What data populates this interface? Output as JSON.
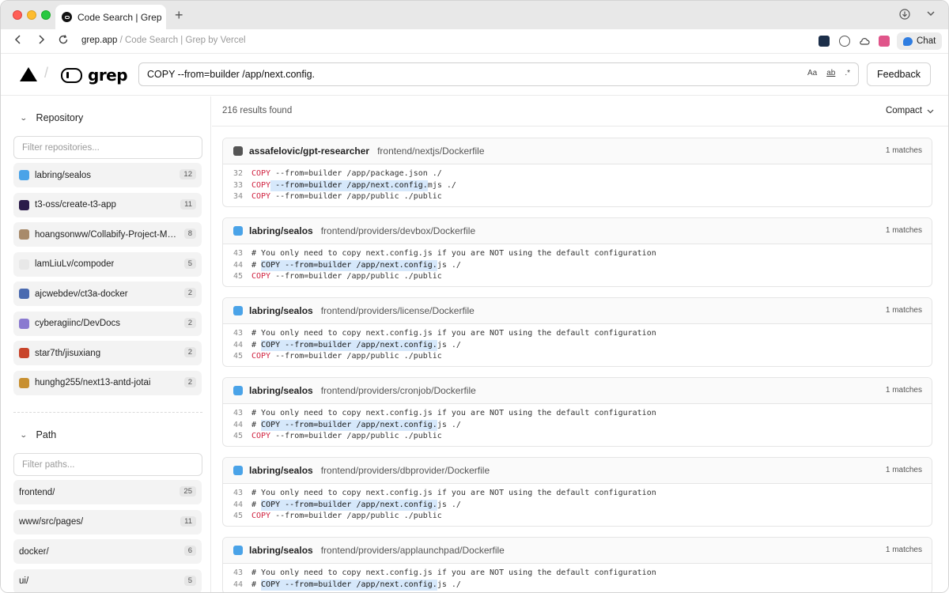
{
  "browser": {
    "tab_title": "Code Search | Grep by",
    "new_tab": "+",
    "url_host": "grep.app",
    "url_rest": " / Code Search | Grep by Vercel",
    "chat_label": "Chat"
  },
  "header": {
    "logo_text": "grep",
    "search_value": "COPY --from=builder /app/next.config.",
    "opt_case": "Aa",
    "opt_words": "ab",
    "opt_regex": ".*",
    "feedback_label": "Feedback"
  },
  "sidebar": {
    "repo_heading": "Repository",
    "repo_filter_placeholder": "Filter repositories...",
    "repos": [
      {
        "name": "labring/sealos",
        "count": "12",
        "color": "#4aa3e8"
      },
      {
        "name": "t3-oss/create-t3-app",
        "count": "11",
        "color": "#2b1b4a"
      },
      {
        "name": "hoangsonww/Collabify-Project-Man...",
        "count": "8",
        "color": "#a88a6a"
      },
      {
        "name": "lamLiuLv/compoder",
        "count": "5",
        "color": "#e8e8e8"
      },
      {
        "name": "ajcwebdev/ct3a-docker",
        "count": "2",
        "color": "#4a6ab0"
      },
      {
        "name": "cyberagiinc/DevDocs",
        "count": "2",
        "color": "#8a7ad0"
      },
      {
        "name": "star7th/jisuxiang",
        "count": "2",
        "color": "#c8442a"
      },
      {
        "name": "hunghg255/next13-antd-jotai",
        "count": "2",
        "color": "#c89030"
      }
    ],
    "path_heading": "Path",
    "path_filter_placeholder": "Filter paths...",
    "paths": [
      {
        "name": "frontend/",
        "count": "25"
      },
      {
        "name": "www/src/pages/",
        "count": "11"
      },
      {
        "name": "docker/",
        "count": "6"
      },
      {
        "name": "ui/",
        "count": "5"
      }
    ]
  },
  "results": {
    "count_text": "216 results found",
    "view_mode": "Compact",
    "items": [
      {
        "repo": "assafelovic/gpt-researcher",
        "path": "frontend/nextjs/Dockerfile",
        "matches": "1 matches",
        "icon_color": "#555555",
        "lines": [
          {
            "n": "32",
            "kind": "copy",
            "pre": "",
            "kw": "COPY",
            "hl": "",
            "rest": " --from=builder /app/package.json ./"
          },
          {
            "n": "33",
            "kind": "copyhl",
            "pre": "",
            "kw": "COPY",
            "hl": " --from=builder /app/next.config.",
            "rest": "mjs ./"
          },
          {
            "n": "34",
            "kind": "copy",
            "pre": "",
            "kw": "COPY",
            "hl": "",
            "rest": " --from=builder /app/public ./public"
          }
        ]
      },
      {
        "repo": "labring/sealos",
        "path": "frontend/providers/devbox/Dockerfile",
        "matches": "1 matches",
        "icon_color": "#4aa3e8",
        "lines": [
          {
            "n": "43",
            "kind": "comment",
            "pre": "# You only need to copy next.config.js if you are NOT using the default configuration",
            "kw": "",
            "hl": "",
            "rest": ""
          },
          {
            "n": "44",
            "kind": "commenthl",
            "pre": "# ",
            "kw": "",
            "hl": "COPY --from=builder /app/next.config.",
            "rest": "js ./"
          },
          {
            "n": "45",
            "kind": "copy",
            "pre": "",
            "kw": "COPY",
            "hl": "",
            "rest": " --from=builder /app/public ./public"
          }
        ]
      },
      {
        "repo": "labring/sealos",
        "path": "frontend/providers/license/Dockerfile",
        "matches": "1 matches",
        "icon_color": "#4aa3e8",
        "lines": [
          {
            "n": "43",
            "kind": "comment",
            "pre": "# You only need to copy next.config.js if you are NOT using the default configuration",
            "kw": "",
            "hl": "",
            "rest": ""
          },
          {
            "n": "44",
            "kind": "commenthl",
            "pre": "# ",
            "kw": "",
            "hl": "COPY --from=builder /app/next.config.",
            "rest": "js ./"
          },
          {
            "n": "45",
            "kind": "copy",
            "pre": "",
            "kw": "COPY",
            "hl": "",
            "rest": " --from=builder /app/public ./public"
          }
        ]
      },
      {
        "repo": "labring/sealos",
        "path": "frontend/providers/cronjob/Dockerfile",
        "matches": "1 matches",
        "icon_color": "#4aa3e8",
        "lines": [
          {
            "n": "43",
            "kind": "comment",
            "pre": "# You only need to copy next.config.js if you are NOT using the default configuration",
            "kw": "",
            "hl": "",
            "rest": ""
          },
          {
            "n": "44",
            "kind": "commenthl",
            "pre": "# ",
            "kw": "",
            "hl": "COPY --from=builder /app/next.config.",
            "rest": "js ./"
          },
          {
            "n": "45",
            "kind": "copy",
            "pre": "",
            "kw": "COPY",
            "hl": "",
            "rest": " --from=builder /app/public ./public"
          }
        ]
      },
      {
        "repo": "labring/sealos",
        "path": "frontend/providers/dbprovider/Dockerfile",
        "matches": "1 matches",
        "icon_color": "#4aa3e8",
        "lines": [
          {
            "n": "43",
            "kind": "comment",
            "pre": "# You only need to copy next.config.js if you are NOT using the default configuration",
            "kw": "",
            "hl": "",
            "rest": ""
          },
          {
            "n": "44",
            "kind": "commenthl",
            "pre": "# ",
            "kw": "",
            "hl": "COPY --from=builder /app/next.config.",
            "rest": "js ./"
          },
          {
            "n": "45",
            "kind": "copy",
            "pre": "",
            "kw": "COPY",
            "hl": "",
            "rest": " --from=builder /app/public ./public"
          }
        ]
      },
      {
        "repo": "labring/sealos",
        "path": "frontend/providers/applaunchpad/Dockerfile",
        "matches": "1 matches",
        "icon_color": "#4aa3e8",
        "lines": [
          {
            "n": "43",
            "kind": "comment",
            "pre": "# You only need to copy next.config.js if you are NOT using the default configuration",
            "kw": "",
            "hl": "",
            "rest": ""
          },
          {
            "n": "44",
            "kind": "commenthl",
            "pre": "# ",
            "kw": "",
            "hl": "COPY --from=builder /app/next.config.",
            "rest": "js ./"
          }
        ]
      }
    ]
  }
}
